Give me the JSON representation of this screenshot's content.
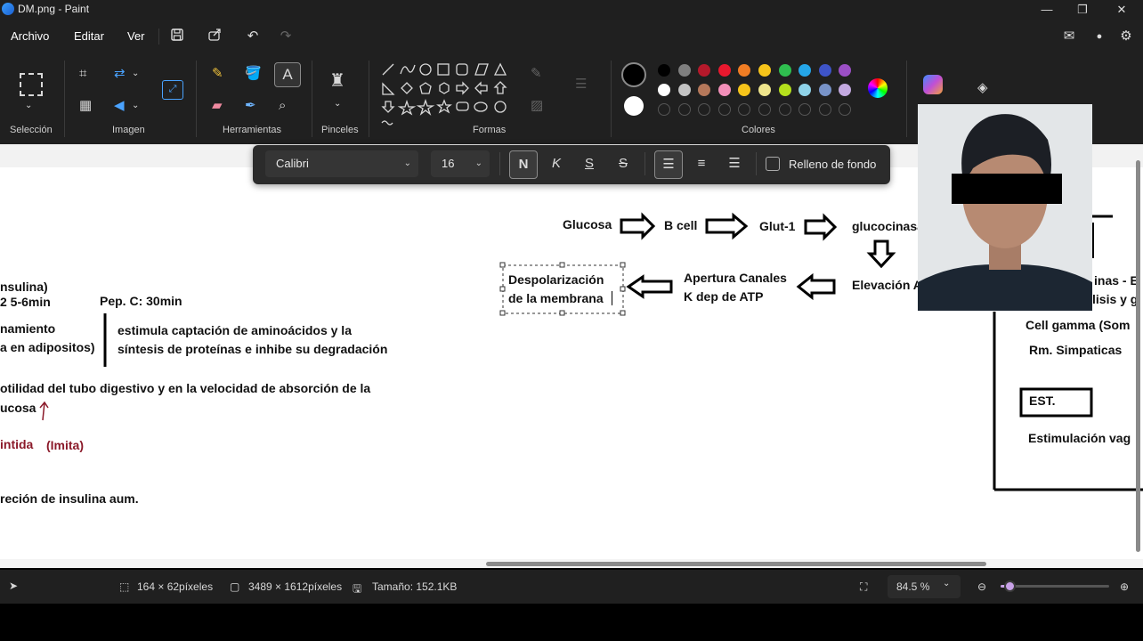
{
  "window": {
    "title": "DM.png - Paint"
  },
  "menu": {
    "archivo": "Archivo",
    "editar": "Editar",
    "ver": "Ver"
  },
  "ribbon": {
    "groups": {
      "seleccion": "Selección",
      "imagen": "Imagen",
      "herramientas": "Herramientas",
      "pinceles": "Pinceles",
      "formas": "Formas",
      "colores": "Colores"
    }
  },
  "textbar": {
    "font": "Calibri",
    "size": "16",
    "bold": "N",
    "italic": "K",
    "underline": "S",
    "strike": "S",
    "fill_label": "Relleno de fondo"
  },
  "colors": {
    "row1": [
      "#000000",
      "#7f7f7f",
      "#b5192b",
      "#e8182e",
      "#f07d24",
      "#f6c41a",
      "#2fbe4f",
      "#25a6e8",
      "#3e54c8",
      "#9b4fc5"
    ],
    "row2": [
      "#ffffff",
      "#c3c3c3",
      "#b5785a",
      "#f28fb9",
      "#f6c41a",
      "#efe58c",
      "#b4e01c",
      "#8fd3e8",
      "#7893c8",
      "#c3a9e0"
    ],
    "selected_primary": "#000000",
    "selected_secondary": "#ffffff"
  },
  "canvas": {
    "flow": {
      "glucosa": "Glucosa",
      "bcell": "B cell",
      "glut1": "Glut-1",
      "glucocinasa": "glucocinasa",
      "elevacion": "Elevación A",
      "apertura_l1": "Apertura Canales",
      "apertura_l2": "K dep de ATP",
      "despol_l1": "Despolarización",
      "despol_l2": "de la membrana"
    },
    "left_notes": {
      "insulina": "nsulina)",
      "line2": "2 5-6min",
      "pepc": "Pep. C: 30min",
      "namiento": "namiento",
      "adipositos": "a en adipositos)",
      "estimula_l1": "estimula captación de aminoácidos y la",
      "estimula_l2": "síntesis de proteínas e inhibe su degradación",
      "motilidad_l1": "otilidad del tubo digestivo y en la velocidad de absorción de la",
      "motilidad_l2": "ucosa",
      "intida": "intida",
      "imita": "(Imita)",
      "secrecion": "reción de insulina aum."
    },
    "right_panel": {
      "inas": "inas - E",
      "isis": "lisis y g",
      "cell_gamma": "Cell gamma (Som",
      "rm": "Rm. Simpaticas",
      "est": "EST.",
      "estimulacion": "Estimulación vag"
    }
  },
  "status": {
    "selection_size": "164 × 62píxeles",
    "canvas_size": "3489 × 1612píxeles",
    "file_size": "Tamaño: 152.1KB",
    "zoom": "84.5 %",
    "zoom_level": 0.08
  }
}
